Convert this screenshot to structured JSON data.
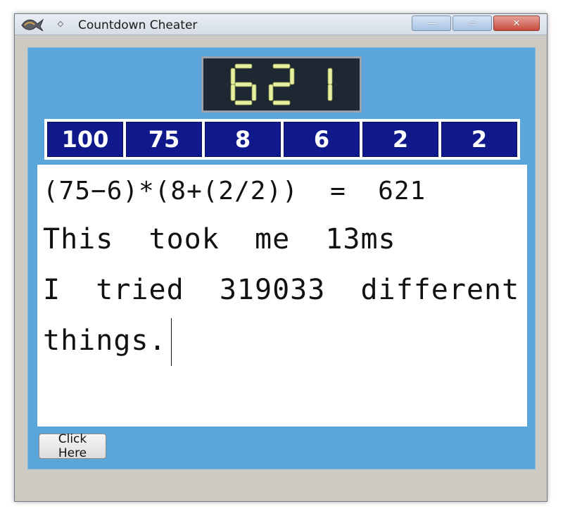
{
  "window": {
    "title": "Countdown Cheater",
    "menu_glyph": "◇",
    "minimize_glyph": "—",
    "maximize_glyph": "▭",
    "close_glyph": "✕"
  },
  "target": {
    "value": "621",
    "color": "#e8f0a0"
  },
  "tiles": [
    "100",
    "75",
    "8",
    "6",
    "2",
    "2"
  ],
  "output": {
    "lines": [
      "(75−6)*(8+(2/2))  =  621",
      "This  took  me  13ms",
      "I  tried  319033  different",
      "things."
    ]
  },
  "button": {
    "label": "Click Here"
  },
  "colors": {
    "content_bg": "#5aa5d9",
    "tile_bg": "#10198c",
    "display_bg": "#1e2832"
  }
}
